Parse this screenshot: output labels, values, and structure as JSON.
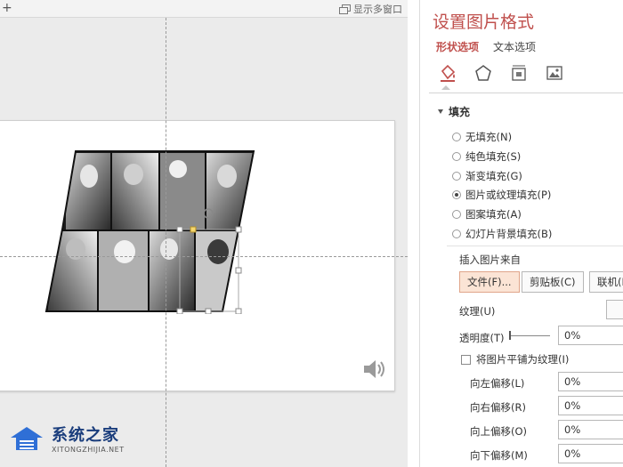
{
  "editor": {
    "plus_symbol": "+",
    "show_multi_window": "显示多窗口"
  },
  "logo": {
    "main": "系统之家",
    "sub": "XITONGZHIJIA.NET"
  },
  "pane": {
    "title": "设置图片格式",
    "tabs": [
      "形状选项",
      "文本选项"
    ],
    "icons": [
      "fill-line-icon",
      "effects-pentagon-icon",
      "size-properties-icon",
      "picture-icon"
    ],
    "fill_section": "填充",
    "fill_options": [
      {
        "label": "无填充(N)",
        "selected": false
      },
      {
        "label": "纯色填充(S)",
        "selected": false
      },
      {
        "label": "渐变填充(G)",
        "selected": false
      },
      {
        "label": "图片或纹理填充(P)",
        "selected": true
      },
      {
        "label": "图案填充(A)",
        "selected": false
      },
      {
        "label": "幻灯片背景填充(B)",
        "selected": false
      }
    ],
    "insert_from": "插入图片来自",
    "buttons": {
      "file": "文件(F)...",
      "clipboard": "剪贴板(C)",
      "online": "联机(E)..."
    },
    "texture_label": "纹理(U)",
    "transparency_label": "透明度(T)",
    "transparency_value": "0%",
    "tile_label": "将图片平铺为纹理(I)",
    "offsets": [
      {
        "label": "向左偏移(L)",
        "value": "0%"
      },
      {
        "label": "向右偏移(R)",
        "value": "0%"
      },
      {
        "label": "向上偏移(O)",
        "value": "0%"
      },
      {
        "label": "向下偏移(M)",
        "value": "0%"
      }
    ]
  },
  "colors": {
    "accent": "#c0504d",
    "selected_button": "#fbe4d5",
    "logo_blue": "#1a3d7c"
  }
}
